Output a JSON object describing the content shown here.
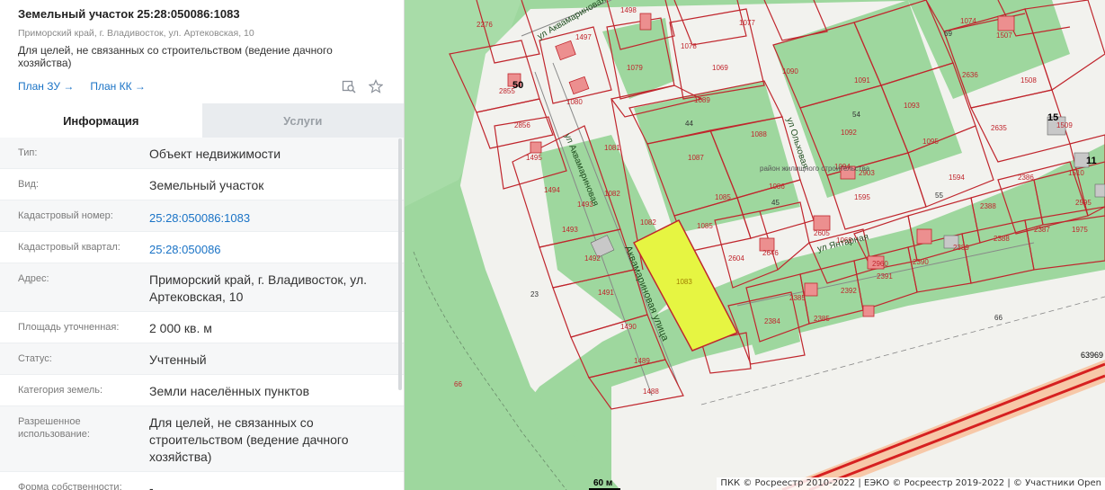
{
  "header": {
    "title": "Земельный участок 25:28:050086:1083",
    "address": "Приморский край, г. Владивосток, ул. Артековская, 10",
    "purpose": "Для целей, не связанных со строительством (ведение дачного хозяйства)",
    "link_plan_zu": "План ЗУ →",
    "link_plan_kk": "План КК →"
  },
  "tabs": {
    "info": "Информация",
    "services": "Услуги"
  },
  "properties": [
    {
      "label": "Тип:",
      "value": "Объект недвижимости"
    },
    {
      "label": "Вид:",
      "value": "Земельный участок"
    },
    {
      "label": "Кадастровый номер:",
      "value": "25:28:050086:1083"
    },
    {
      "label": "Кадастровый квартал:",
      "value": "25:28:050086"
    },
    {
      "label": "Адрес:",
      "value": "Приморский край, г. Владивосток, ул. Артековская, 10"
    },
    {
      "label": "Площадь уточненная:",
      "value": "2 000 кв. м"
    },
    {
      "label": "Статус:",
      "value": "Учтенный"
    },
    {
      "label": "Категория земель:",
      "value": "Земли населённых пунктов"
    },
    {
      "label": "Разрешенное использование:",
      "value": "Для целей, не связанных со строительством (ведение дачного хозяйства)"
    },
    {
      "label": "Форма собственности:",
      "value": "-"
    }
  ],
  "map": {
    "selected_parcel": "1083",
    "parcels": [
      "2276",
      "1498",
      "1077",
      "1074",
      "1507",
      "1497",
      "1078",
      "1079",
      "1069",
      "1090",
      "1089",
      "1091",
      "1093",
      "1088",
      "1092",
      "1087",
      "1094",
      "2903",
      "1595",
      "1594",
      "1095",
      "1085",
      "1086",
      "1081",
      "1082",
      "1493",
      "1494",
      "1495",
      "2855",
      "2856",
      "1080",
      "2636",
      "1508",
      "1509",
      "2635",
      "2386",
      "1510",
      "2595",
      "2387",
      "2388",
      "2388",
      "2389",
      "2390",
      "2391",
      "2392",
      "2385",
      "2384",
      "2605",
      "2604",
      "2646",
      "2960",
      "1069",
      "1490",
      "1491",
      "1489",
      "1488",
      "1492",
      "66"
    ],
    "house_numbers": [
      "50",
      "15",
      "11"
    ],
    "street_labels": [
      "ул Аквамариновая",
      "Аквамариновая улица",
      "ул Ольховая",
      "ул Янтарная",
      "район жилищного строительства"
    ],
    "misc_labels": [
      "60 м",
      "63969",
      "23",
      "66",
      "44",
      "54",
      "55",
      "45",
      "2386",
      "69"
    ],
    "attribution": "ПКК © Росреестр 2010-2022 | ЕЭКО © Росреестр 2019-2022 | © Участники Open"
  },
  "colors": {
    "accent": "#1a73c6",
    "parcel_border": "#c0262d",
    "selected_fill": "#e6f542",
    "green": "#9ed79e",
    "road": "#d62020"
  }
}
